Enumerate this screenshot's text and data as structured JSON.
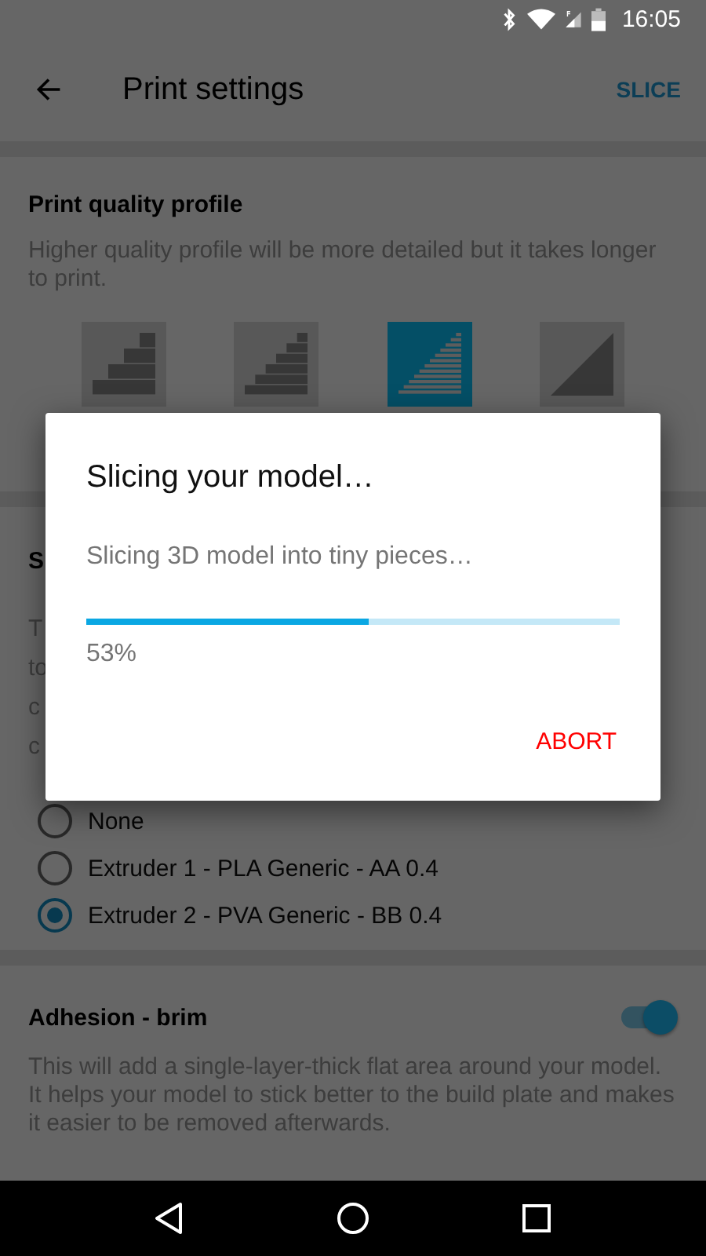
{
  "status_bar": {
    "time": "16:05"
  },
  "toolbar": {
    "title": "Print settings",
    "action": "SLICE"
  },
  "sections": [
    {
      "kind": "quality",
      "title": "Print quality profile",
      "description": "Higher quality profile will be more detailed but it takes longer to print.",
      "profiles": [
        {
          "selected": false
        },
        {
          "selected": false
        },
        {
          "selected": true
        },
        {
          "selected": false
        }
      ]
    },
    {
      "kind": "support",
      "title": "S",
      "description_lines": [
        "T",
        "to",
        "c",
        "c"
      ],
      "options": [
        {
          "label": "None",
          "selected": false
        },
        {
          "label": "Extruder 1 - PLA Generic - AA 0.4",
          "selected": false
        },
        {
          "label": "Extruder 2 - PVA Generic - BB 0.4",
          "selected": true
        }
      ]
    },
    {
      "kind": "toggle",
      "title": "Adhesion - brim",
      "on": true,
      "description": "This will add a single-layer-thick flat area around your model. It helps your model to stick better to the build plate and makes it easier to be removed afterwards."
    }
  ],
  "dialog": {
    "title": "Slicing your model…",
    "message": "Slicing 3D model into tiny pieces…",
    "level": 0.53,
    "reading": "53%",
    "button": "ABORT"
  }
}
